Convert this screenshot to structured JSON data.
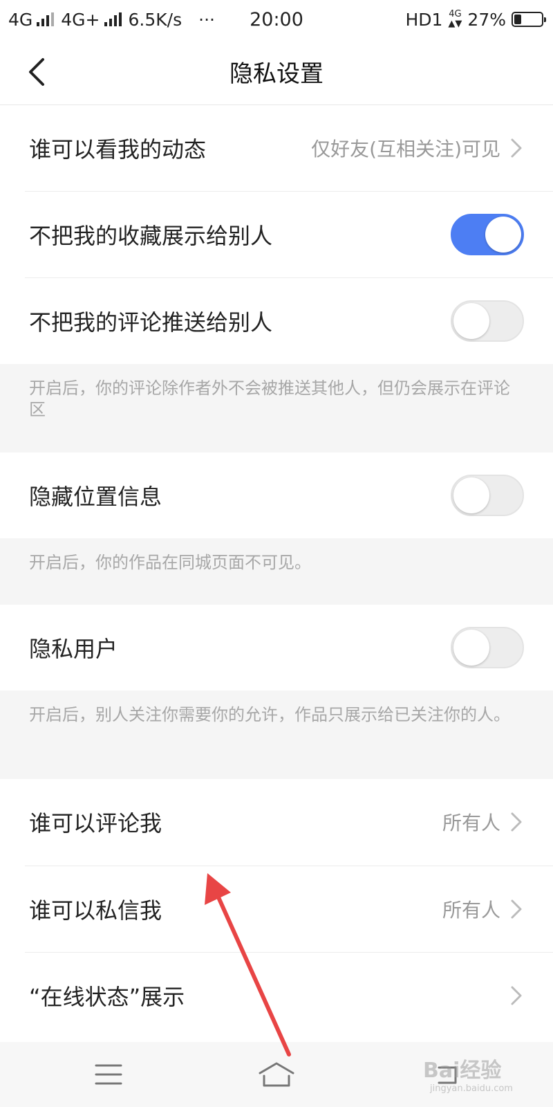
{
  "status_bar": {
    "carrier1": "4G",
    "carrier2": "4G+",
    "speed": "6.5K/s",
    "dots": "···",
    "time": "20:00",
    "hd": "HD1",
    "net_mini": "4G",
    "battery_pct": "27%",
    "battery_level": 0.27
  },
  "header": {
    "title": "隐私设置"
  },
  "rows": [
    {
      "label": "谁可以看我的动态",
      "value": "仅好友(互相关注)可见"
    },
    {
      "label": "不把我的收藏展示给别人",
      "toggle_on": true
    },
    {
      "label": "不把我的评论推送给别人",
      "toggle_on": false
    },
    {
      "label": "隐藏位置信息",
      "toggle_on": false
    },
    {
      "label": "隐私用户",
      "toggle_on": false
    },
    {
      "label": "谁可以评论我",
      "value": "所有人"
    },
    {
      "label": "谁可以私信我",
      "value": "所有人"
    },
    {
      "label": "“在线状态”展示",
      "value": ""
    }
  ],
  "notes": [
    "开启后，你的评论除作者外不会被推送其他人，但仍会展示在评论区",
    "开启后，你的作品在同城页面不可见。",
    "开启后，别人关注你需要你的允许，作品只展示给已关注你的人。"
  ],
  "nav": {
    "menu_icon": "menu-icon",
    "home_icon": "home-icon",
    "back_icon": "back-nav-icon"
  },
  "watermark": {
    "text": "Bai经验",
    "sub": "jingyan.baidu.com"
  },
  "colors": {
    "accent": "#4d7ef3",
    "annotation_arrow": "#e84545"
  }
}
